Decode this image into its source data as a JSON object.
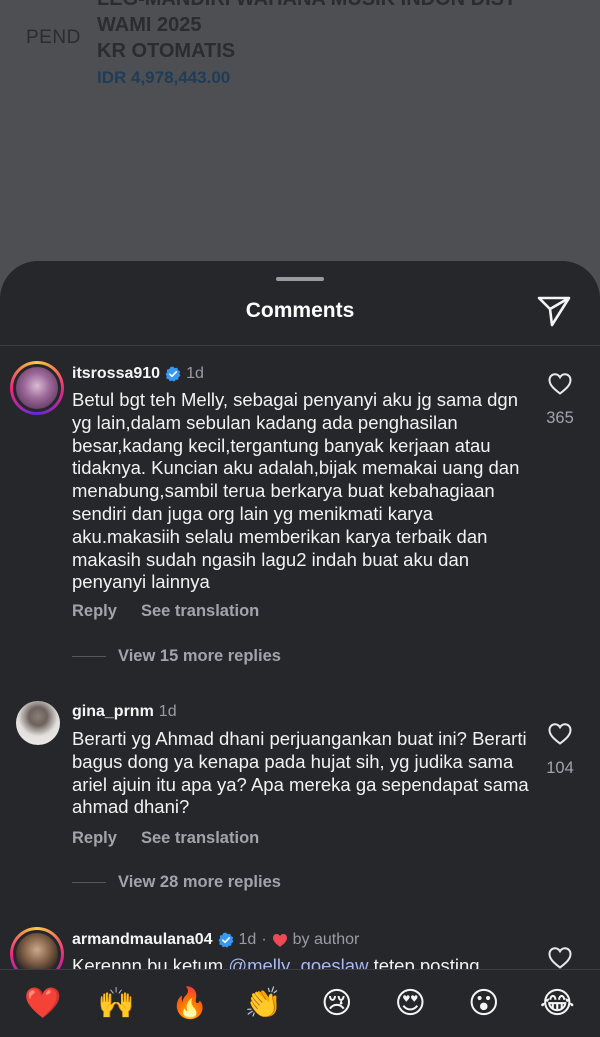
{
  "background_post": {
    "left_label": "PEND",
    "lines": [
      "LEG-MANDIRI WAHANA MUSIK INDON DIST",
      "WAMI 2025",
      "KR OTOMATIS"
    ],
    "amount": "IDR 4,978,443.00"
  },
  "sheet": {
    "title": "Comments"
  },
  "comments": [
    {
      "username": "itsrossa910",
      "time": "1d",
      "text": "Betul bgt teh Melly, sebagai penyanyi aku jg sama dgn yg lain,dalam sebulan kadang ada penghasilan besar,kadang kecil,tergantung banyak kerjaan atau tidaknya. Kuncian aku adalah,bijak memakai uang dan menabung,sambil terua berkarya buat kebahagiaan sendiri dan juga org lain yg menikmati karya aku.makasiih selalu memberikan karya terbaik dan makasih sudah ngasih lagu2 indah buat aku dan penyanyi lainnya",
      "reply_label": "Reply",
      "translate_label": "See translation",
      "more_replies": "View 15 more replies",
      "likes": "365"
    },
    {
      "username": "gina_prnm",
      "time": "1d",
      "text": "Berarti yg Ahmad dhani perjuangankan buat ini? Berarti bagus dong ya kenapa pada hujat sih, yg judika sama ariel ajuin itu apa ya? Apa mereka ga sependapat sama ahmad dhani?",
      "reply_label": "Reply",
      "translate_label": "See translation",
      "more_replies": "View 28 more replies",
      "likes": "104"
    },
    {
      "username": "armandmaulana04",
      "time": "1d",
      "separator": "·",
      "liked_by": "by author",
      "text_start": "Kerennn bu ketum ",
      "mention": "@melly_goeslaw",
      "text_end": " tetep posting"
    }
  ],
  "emoji_bar": [
    "❤️",
    "🙌",
    "🔥",
    "👏",
    "😢",
    "😍",
    "😮",
    "😂"
  ],
  "colors": {
    "sheet_bg": "#25272b",
    "verified": "#3897f0",
    "heart_red": "#ed4956"
  }
}
